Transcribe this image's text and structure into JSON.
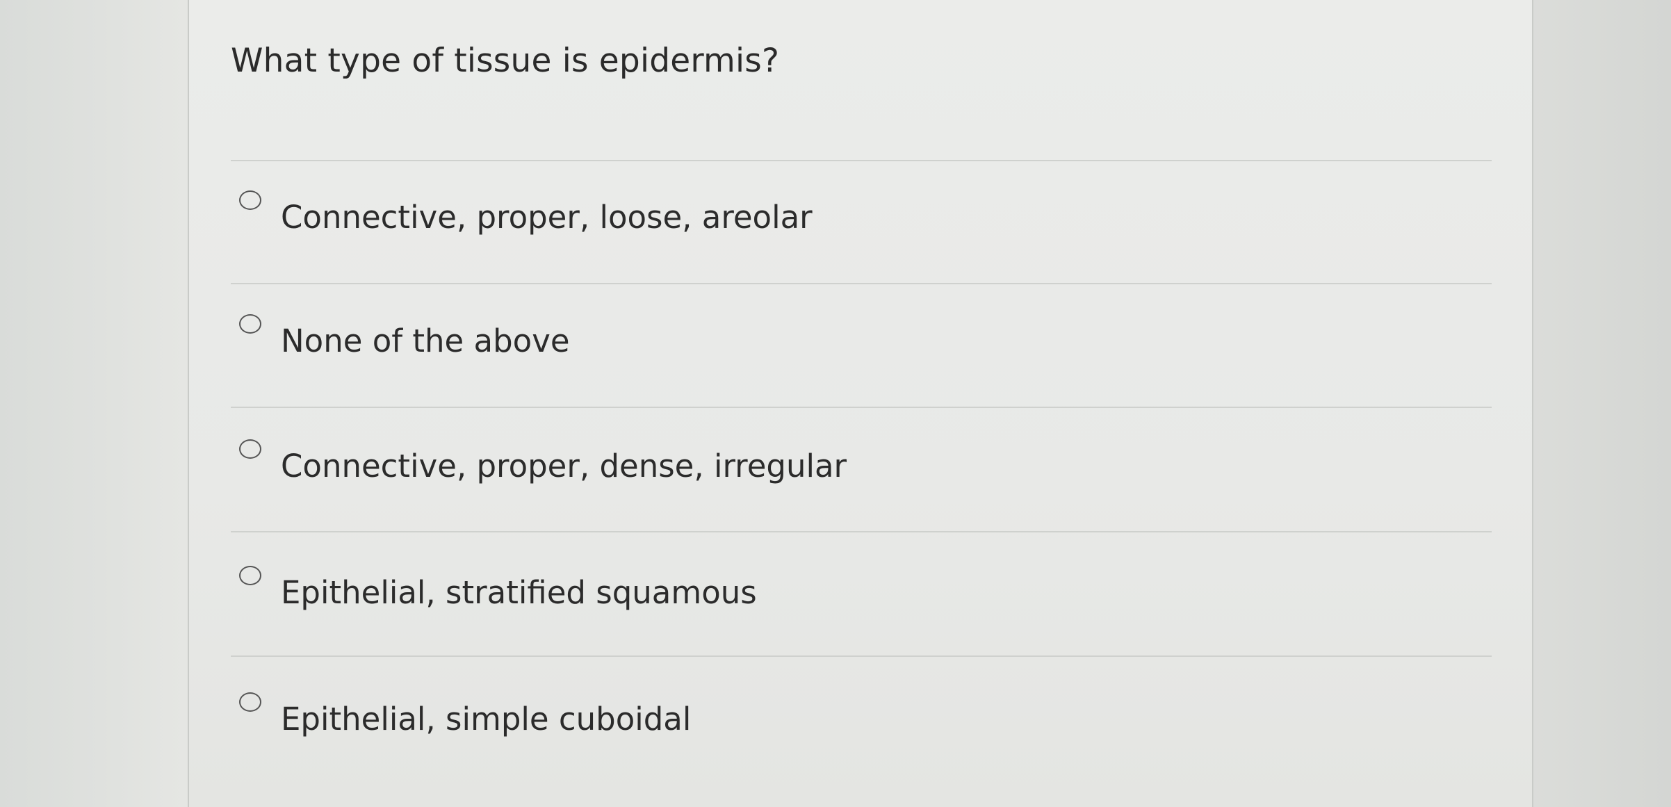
{
  "question": {
    "text": "What type of tissue is epidermis?"
  },
  "options": [
    {
      "label": "Connective, proper, loose, areolar",
      "selected": false
    },
    {
      "label": "None of the above",
      "selected": false
    },
    {
      "label": "Connective, proper, dense, irregular",
      "selected": false
    },
    {
      "label": "Epithelial, stratified squamous",
      "selected": false
    },
    {
      "label": "Epithelial, simple cuboidal",
      "selected": false
    }
  ]
}
